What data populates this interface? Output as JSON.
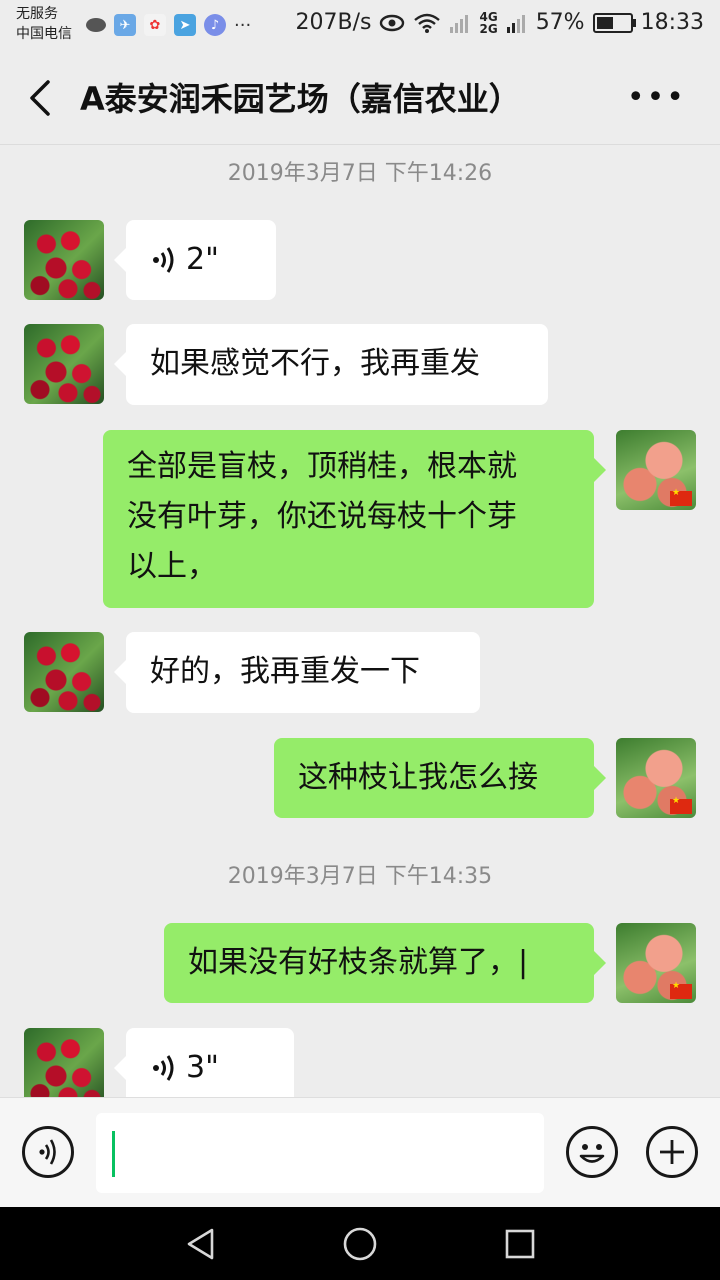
{
  "status_bar": {
    "carrier_line1": "无服务",
    "carrier_line2": "中国电信",
    "net_speed": "207B/s",
    "net_type_top": "4G",
    "net_type_bottom": "2G",
    "battery_percent": "57%",
    "battery_level": 0.57,
    "time": "18:33"
  },
  "header": {
    "title": "A泰安润禾园艺场（嘉信农业）"
  },
  "messages": [
    {
      "kind": "timestamp",
      "text": "2019年3月7日 下午14:26"
    },
    {
      "kind": "voice",
      "side": "in",
      "duration": "2\""
    },
    {
      "kind": "text",
      "side": "in",
      "text": "如果感觉不行，我再重发"
    },
    {
      "kind": "text",
      "side": "out",
      "lines": [
        "全部是盲枝，顶稍桂，根本就",
        "没有叶芽，你还说每枝十个芽",
        "以上，"
      ]
    },
    {
      "kind": "text",
      "side": "in",
      "text": "好的，我再重发一下"
    },
    {
      "kind": "text",
      "side": "out",
      "text": "这种枝让我怎么接"
    },
    {
      "kind": "timestamp",
      "text": "2019年3月7日 下午14:35"
    },
    {
      "kind": "text",
      "side": "out",
      "text": "如果没有好枝条就算了，|"
    },
    {
      "kind": "voice",
      "side": "in",
      "duration": "3\""
    }
  ],
  "input_bar": {
    "value": ""
  },
  "icons": {
    "back": "back-arrow-icon",
    "more": "more-dots-icon",
    "voice_toggle": "voice-mode-icon",
    "emoji": "emoji-icon",
    "plus": "plus-icon",
    "nav_back": "nav-back-icon",
    "nav_home": "nav-home-icon",
    "nav_recent": "nav-recent-icon"
  },
  "colors": {
    "out_bubble": "#95ec69",
    "in_bubble": "#ffffff",
    "background": "#ededed",
    "caret": "#07c160"
  }
}
